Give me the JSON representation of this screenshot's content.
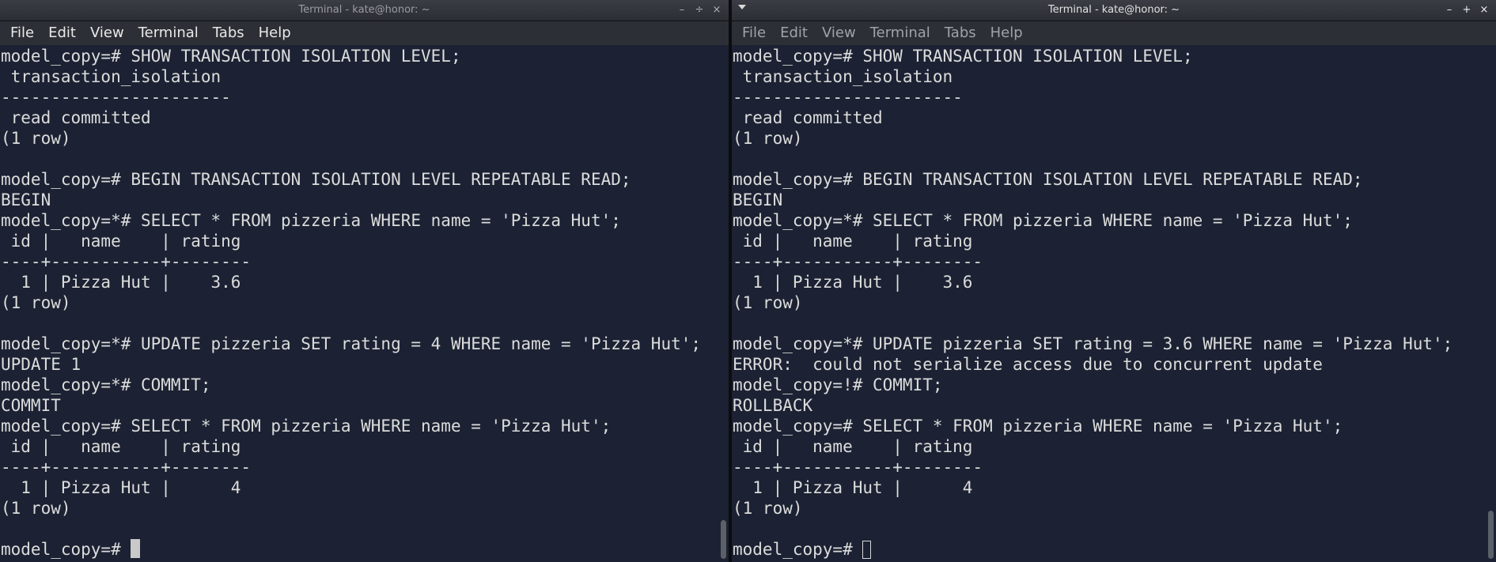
{
  "left": {
    "title": "Terminal - kate@honor: ~",
    "menu": [
      "File",
      "Edit",
      "View",
      "Terminal",
      "Tabs",
      "Help"
    ],
    "lines": [
      "model_copy=# SHOW TRANSACTION ISOLATION LEVEL;",
      " transaction_isolation",
      "-----------------------",
      " read committed",
      "(1 row)",
      "",
      "model_copy=# BEGIN TRANSACTION ISOLATION LEVEL REPEATABLE READ;",
      "BEGIN",
      "model_copy=*# SELECT * FROM pizzeria WHERE name = 'Pizza Hut';",
      " id |   name    | rating",
      "----+-----------+--------",
      "  1 | Pizza Hut |    3.6",
      "(1 row)",
      "",
      "model_copy=*# UPDATE pizzeria SET rating = 4 WHERE name = 'Pizza Hut';",
      "UPDATE 1",
      "model_copy=*# COMMIT;",
      "COMMIT",
      "model_copy=# SELECT * FROM pizzeria WHERE name = 'Pizza Hut';",
      " id |   name    | rating",
      "----+-----------+--------",
      "  1 | Pizza Hut |      4",
      "(1 row)",
      ""
    ],
    "prompt": "model_copy=# "
  },
  "right": {
    "title": "Terminal - kate@honor: ~",
    "menu": [
      "File",
      "Edit",
      "View",
      "Terminal",
      "Tabs",
      "Help"
    ],
    "lines": [
      "model_copy=# SHOW TRANSACTION ISOLATION LEVEL;",
      " transaction_isolation",
      "-----------------------",
      " read committed",
      "(1 row)",
      "",
      "model_copy=# BEGIN TRANSACTION ISOLATION LEVEL REPEATABLE READ;",
      "BEGIN",
      "model_copy=*# SELECT * FROM pizzeria WHERE name = 'Pizza Hut';",
      " id |   name    | rating",
      "----+-----------+--------",
      "  1 | Pizza Hut |    3.6",
      "(1 row)",
      "",
      "model_copy=*# UPDATE pizzeria SET rating = 3.6 WHERE name = 'Pizza Hut';",
      "ERROR:  could not serialize access due to concurrent update",
      "model_copy=!# COMMIT;",
      "ROLLBACK",
      "model_copy=# SELECT * FROM pizzeria WHERE name = 'Pizza Hut';",
      " id |   name    | rating",
      "----+-----------+--------",
      "  1 | Pizza Hut |      4",
      "(1 row)",
      ""
    ],
    "prompt": "model_copy=# "
  },
  "wm_buttons": {
    "minimize": "–",
    "maximize_left": "÷",
    "maximize_right": "+",
    "close": "×"
  },
  "colors": {
    "terminal_bg": "#1c2233",
    "text": "#dcdcdc",
    "menubar_bg": "#2c3036"
  }
}
